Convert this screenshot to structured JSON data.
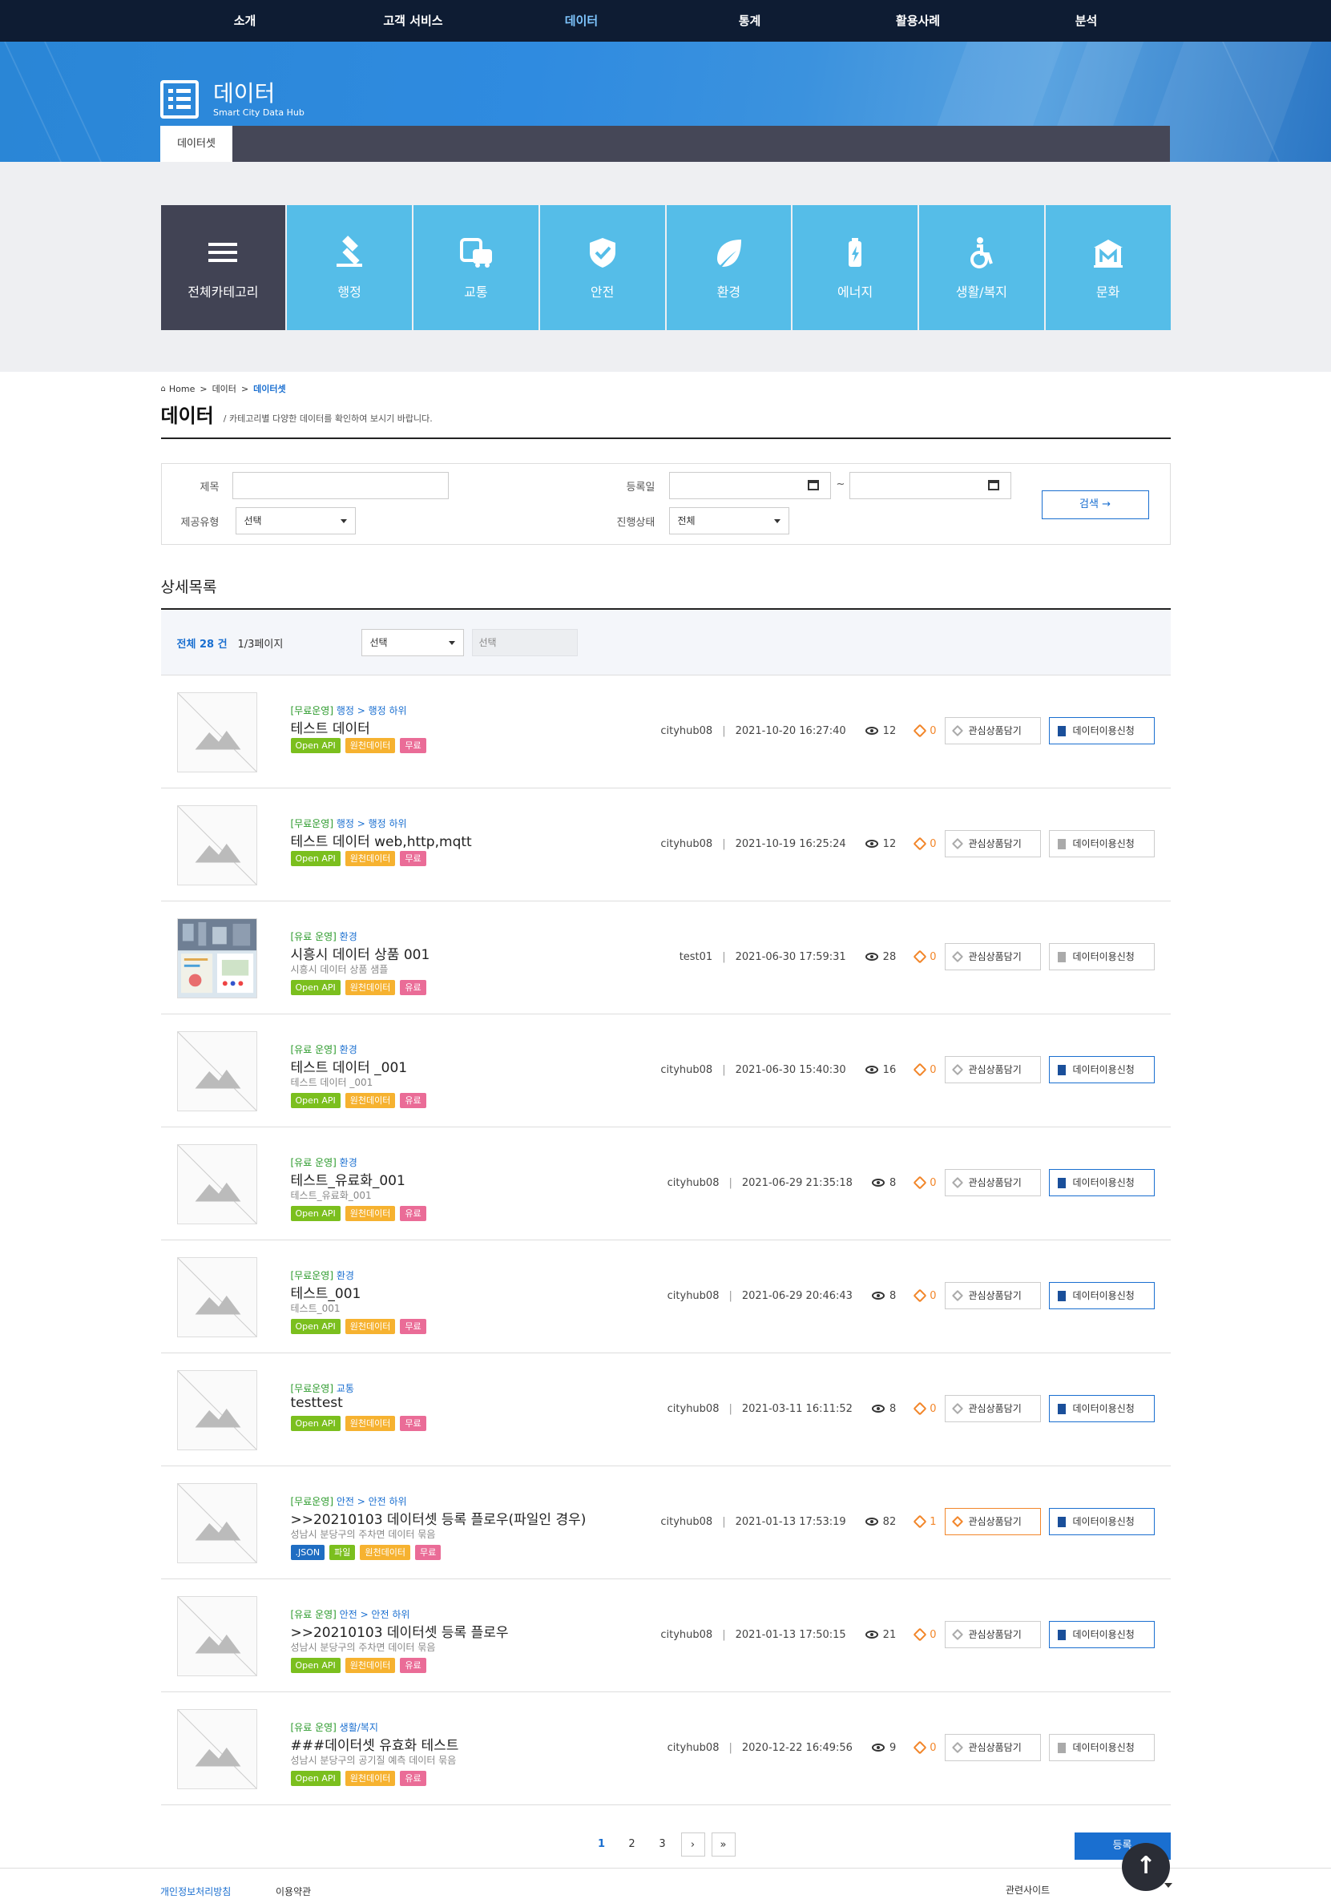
{
  "nav": [
    "소개",
    "고객 서비스",
    "데이터",
    "통계",
    "활용사례",
    "분석"
  ],
  "nav_active_index": 2,
  "hero": {
    "title": "데이터",
    "subtitle": "Smart City Data Hub",
    "tab": "데이터셋"
  },
  "categories": [
    {
      "label": "전체카테고리",
      "icon": "menu-icon"
    },
    {
      "label": "행정",
      "icon": "gavel-icon"
    },
    {
      "label": "교통",
      "icon": "bus-car-icon"
    },
    {
      "label": "안전",
      "icon": "shield-check-icon"
    },
    {
      "label": "환경",
      "icon": "leaf-icon"
    },
    {
      "label": "에너지",
      "icon": "battery-icon"
    },
    {
      "label": "생활/복지",
      "icon": "wheelchair-icon"
    },
    {
      "label": "문화",
      "icon": "museum-icon"
    }
  ],
  "breadcrumb": {
    "home": "Home",
    "level1": "데이터",
    "current": "데이터셋"
  },
  "page": {
    "title": "데이터",
    "desc": "카테고리별 다양한 데이터를 확인하여 보시기 바랍니다."
  },
  "search": {
    "title_label": "제목",
    "date_label": "등록일",
    "tilde": "~",
    "type_label": "제공유형",
    "type_value": "선택",
    "status_label": "진행상태",
    "status_value": "전체",
    "button": "검색 →"
  },
  "list": {
    "subtitle": "상세목록",
    "total": "전체 28 건",
    "page_info": "1/3페이지",
    "filter_select": "선택",
    "keyword_placeholder": "선택",
    "fav_label": "관심상품담기",
    "req_label": "데이터이용신청"
  },
  "items": [
    {
      "cat_prefix": "[무료운영]",
      "cat_path": "행정 > 행정 하위",
      "title": "테스트 데이터",
      "desc": "",
      "tags": [
        "Open API",
        "원천데이터",
        "무료"
      ],
      "user": "cityhub08",
      "date": "2021-10-20 16:27:40",
      "views": "12",
      "likes": "0",
      "fav_on": false,
      "req_on": true,
      "photo": false
    },
    {
      "cat_prefix": "[무료운영]",
      "cat_path": "행정 > 행정 하위",
      "title": "테스트 데이터 web,http,mqtt",
      "desc": "",
      "tags": [
        "Open API",
        "원천데이터",
        "무료"
      ],
      "user": "cityhub08",
      "date": "2021-10-19 16:25:24",
      "views": "12",
      "likes": "0",
      "fav_on": false,
      "req_on": false,
      "photo": false
    },
    {
      "cat_prefix": "[유료 운영]",
      "cat_path": "환경",
      "title": "시흥시 데이터 상품 001",
      "desc": "시흥시 데이터 상품 샘플",
      "tags": [
        "Open API",
        "원천데이터",
        "유료"
      ],
      "user": "test01",
      "date": "2021-06-30 17:59:31",
      "views": "28",
      "likes": "0",
      "fav_on": false,
      "req_on": false,
      "photo": true
    },
    {
      "cat_prefix": "[유료 운영]",
      "cat_path": "환경",
      "title": "테스트 데이터 _001",
      "desc": "테스트 데이터 _001",
      "tags": [
        "Open API",
        "원천데이터",
        "유료"
      ],
      "user": "cityhub08",
      "date": "2021-06-30 15:40:30",
      "views": "16",
      "likes": "0",
      "fav_on": false,
      "req_on": true,
      "photo": false
    },
    {
      "cat_prefix": "[유료 운영]",
      "cat_path": "환경",
      "title": "테스트_유료화_001",
      "desc": "테스트_유료화_001",
      "tags": [
        "Open API",
        "원천데이터",
        "유료"
      ],
      "user": "cityhub08",
      "date": "2021-06-29 21:35:18",
      "views": "8",
      "likes": "0",
      "fav_on": false,
      "req_on": true,
      "photo": false
    },
    {
      "cat_prefix": "[무료운영]",
      "cat_path": "환경",
      "title": "테스트_001",
      "desc": "테스트_001",
      "tags": [
        "Open API",
        "원천데이터",
        "무료"
      ],
      "user": "cityhub08",
      "date": "2021-06-29 20:46:43",
      "views": "8",
      "likes": "0",
      "fav_on": false,
      "req_on": true,
      "photo": false
    },
    {
      "cat_prefix": "[무료운영]",
      "cat_path": "교통",
      "title": "testtest",
      "desc": "",
      "tags": [
        "Open API",
        "원천데이터",
        "무료"
      ],
      "user": "cityhub08",
      "date": "2021-03-11 16:11:52",
      "views": "8",
      "likes": "0",
      "fav_on": false,
      "req_on": true,
      "photo": false
    },
    {
      "cat_prefix": "[무료운영]",
      "cat_path": "안전 > 안전 하위",
      "title": ">>20210103 데이터셋 등록 플로우(파일인 경우)",
      "desc": "성남시 분당구의 주차면 데이터 묶음",
      "tags": [
        ".JSON",
        "파일",
        "원천데이터",
        "무료"
      ],
      "user": "cityhub08",
      "date": "2021-01-13 17:53:19",
      "views": "82",
      "likes": "1",
      "fav_on": true,
      "req_on": true,
      "photo": false
    },
    {
      "cat_prefix": "[유료 운영]",
      "cat_path": "안전 > 안전 하위",
      "title": ">>20210103 데이터셋 등록 플로우",
      "desc": "성남시 분당구의 주차면 데이터 묶음",
      "tags": [
        "Open API",
        "원천데이터",
        "유료"
      ],
      "user": "cityhub08",
      "date": "2021-01-13 17:50:15",
      "views": "21",
      "likes": "0",
      "fav_on": false,
      "req_on": true,
      "photo": false
    },
    {
      "cat_prefix": "[유료 운영]",
      "cat_path": "생활/복지",
      "title": "###데이터셋 유효화 테스트",
      "desc": "성남시 분당구의 공기질 예측 데이터 묶음",
      "tags": [
        "Open API",
        "원천데이터",
        "유료"
      ],
      "user": "cityhub08",
      "date": "2020-12-22 16:49:56",
      "views": "9",
      "likes": "0",
      "fav_on": false,
      "req_on": false,
      "photo": false
    }
  ],
  "pagination": {
    "pages": [
      "1",
      "2",
      "3"
    ],
    "active": "1",
    "next": "›",
    "last": "»",
    "register": "등록"
  },
  "footer": {
    "privacy": "개인정보처리방침",
    "terms": "이용약관",
    "related": "관련사이트"
  },
  "totop": "↑",
  "colors": {
    "nav_bg": "#0e1c33",
    "category_bg": "#55bde8",
    "category_all_bg": "#414354",
    "accent": "#1a6fd0"
  }
}
